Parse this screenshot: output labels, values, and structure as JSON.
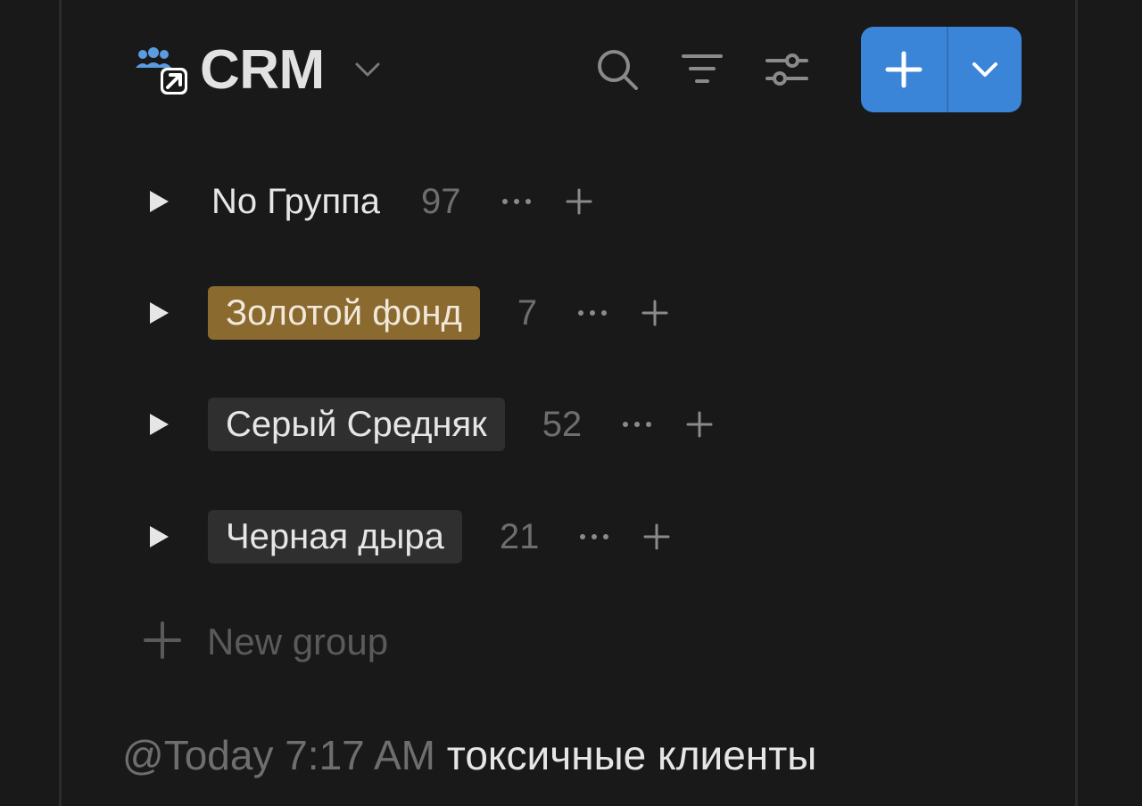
{
  "header": {
    "icon": "people-share-icon",
    "title": "CRM",
    "toolbar": {
      "search_icon": "search-icon",
      "sort_icon": "sort-icon",
      "settings_icon": "sliders-icon",
      "new_button_icon": "plus-icon",
      "new_button_menu_icon": "chevron-down-icon"
    }
  },
  "groups": [
    {
      "label": "No Группа",
      "count": "97",
      "style": "plain"
    },
    {
      "label": "Золотой фонд",
      "count": "7",
      "style": "gold"
    },
    {
      "label": "Серый Средняк",
      "count": "52",
      "style": "gray"
    },
    {
      "label": "Черная дыра",
      "count": "21",
      "style": "gray"
    }
  ],
  "new_group": {
    "label": "New group"
  },
  "footer": {
    "mention": "@Today 7:17 AM",
    "note": "токсичные клиенты"
  },
  "colors": {
    "background": "#191919",
    "accent_blue": "#3a85d8",
    "gold_tag": "#8a6a2e",
    "gray_tag": "#2f2f2f",
    "icon_blue": "#5b9be0"
  }
}
